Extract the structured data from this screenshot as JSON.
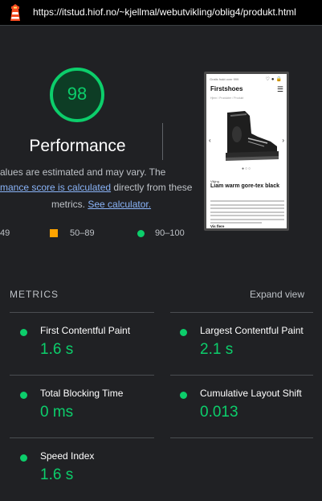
{
  "url": "https://itstud.hiof.no/~kjellmal/webutvikling/oblig4/produkt.html",
  "score": "98",
  "title": "Performance",
  "description": {
    "line1": "alues are estimated and may vary. The",
    "line2_link": "mance score is calculated",
    "line2_rest": " directly from these",
    "line3_prefix": "metrics. ",
    "line3_link": "See calculator."
  },
  "legend": {
    "fail": "49",
    "average": "50–89",
    "pass": "90–100"
  },
  "thumbnail": {
    "topbar": "Gratis frakt over 999",
    "brand": "Firstshoes",
    "breadcrumb": "Hjem  /  Produkter  /  Produkt",
    "vendor": "Viking",
    "product_name": "Liam warm gore-tex black",
    "more_link": "Vis flere"
  },
  "metrics": {
    "label": "METRICS",
    "expand": "Expand view",
    "items": [
      {
        "title": "First Contentful Paint",
        "value": "1.6 s"
      },
      {
        "title": "Largest Contentful Paint",
        "value": "2.1 s"
      },
      {
        "title": "Total Blocking Time",
        "value": "0 ms"
      },
      {
        "title": "Cumulative Layout Shift",
        "value": "0.013"
      },
      {
        "title": "Speed Index",
        "value": "1.6 s"
      }
    ]
  },
  "colors": {
    "pass": "#0cce6b",
    "average": "#ffa400",
    "background": "#202124",
    "link": "#8ab4f8"
  }
}
